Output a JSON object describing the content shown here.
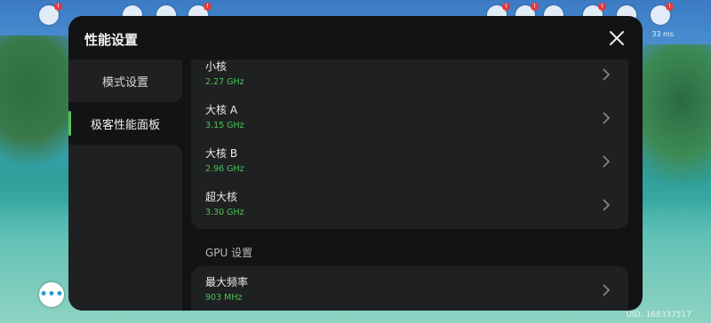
{
  "panel": {
    "title": "性能设置",
    "close_icon": "close-icon"
  },
  "sidebar": {
    "items": [
      {
        "label": "模式设置",
        "active": false
      },
      {
        "label": "极客性能面板",
        "active": true
      }
    ]
  },
  "cpu": {
    "rows": [
      {
        "name": "小核",
        "value": "2.27 GHz"
      },
      {
        "name": "大核 A",
        "value": "3.15 GHz"
      },
      {
        "name": "大核 B",
        "value": "2.96 GHz"
      },
      {
        "name": "超大核",
        "value": "3.30 GHz"
      }
    ]
  },
  "gpu": {
    "section_label": "GPU 设置",
    "rows": [
      {
        "name": "最大频率",
        "value": "903 MHz"
      }
    ]
  },
  "background": {
    "uid": "UID: 168337517",
    "status": "33 ms"
  },
  "colors": {
    "accent": "#4cc35a",
    "panel": "#121314",
    "card": "#1f2021"
  }
}
